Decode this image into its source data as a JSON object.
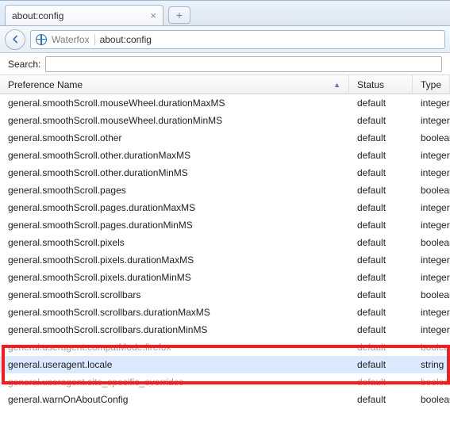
{
  "tab": {
    "title": "about:config"
  },
  "nav": {
    "identity_label": "Waterfox",
    "url": "about:config"
  },
  "search": {
    "label": "Search:",
    "value": ""
  },
  "columns": {
    "name": "Preference Name",
    "status": "Status",
    "type": "Type"
  },
  "rows": [
    {
      "name": "general.smoothScroll.mouseWheel.durationMaxMS",
      "status": "default",
      "type": "integer"
    },
    {
      "name": "general.smoothScroll.mouseWheel.durationMinMS",
      "status": "default",
      "type": "integer"
    },
    {
      "name": "general.smoothScroll.other",
      "status": "default",
      "type": "boolean"
    },
    {
      "name": "general.smoothScroll.other.durationMaxMS",
      "status": "default",
      "type": "integer"
    },
    {
      "name": "general.smoothScroll.other.durationMinMS",
      "status": "default",
      "type": "integer"
    },
    {
      "name": "general.smoothScroll.pages",
      "status": "default",
      "type": "boolean"
    },
    {
      "name": "general.smoothScroll.pages.durationMaxMS",
      "status": "default",
      "type": "integer"
    },
    {
      "name": "general.smoothScroll.pages.durationMinMS",
      "status": "default",
      "type": "integer"
    },
    {
      "name": "general.smoothScroll.pixels",
      "status": "default",
      "type": "boolean"
    },
    {
      "name": "general.smoothScroll.pixels.durationMaxMS",
      "status": "default",
      "type": "integer"
    },
    {
      "name": "general.smoothScroll.pixels.durationMinMS",
      "status": "default",
      "type": "integer"
    },
    {
      "name": "general.smoothScroll.scrollbars",
      "status": "default",
      "type": "boolean"
    },
    {
      "name": "general.smoothScroll.scrollbars.durationMaxMS",
      "status": "default",
      "type": "integer"
    },
    {
      "name": "general.smoothScroll.scrollbars.durationMinMS",
      "status": "default",
      "type": "integer"
    },
    {
      "name": "general.useragent.compatMode.firefox",
      "status": "default",
      "type": "boolean"
    },
    {
      "name": "general.useragent.locale",
      "status": "default",
      "type": "string"
    },
    {
      "name": "general.useragent.site_specific_overrides",
      "status": "default",
      "type": "boolean"
    },
    {
      "name": "general.warnOnAboutConfig",
      "status": "default",
      "type": "boolean"
    }
  ],
  "highlight_index": 15,
  "obscured_indices": [
    14,
    16
  ]
}
